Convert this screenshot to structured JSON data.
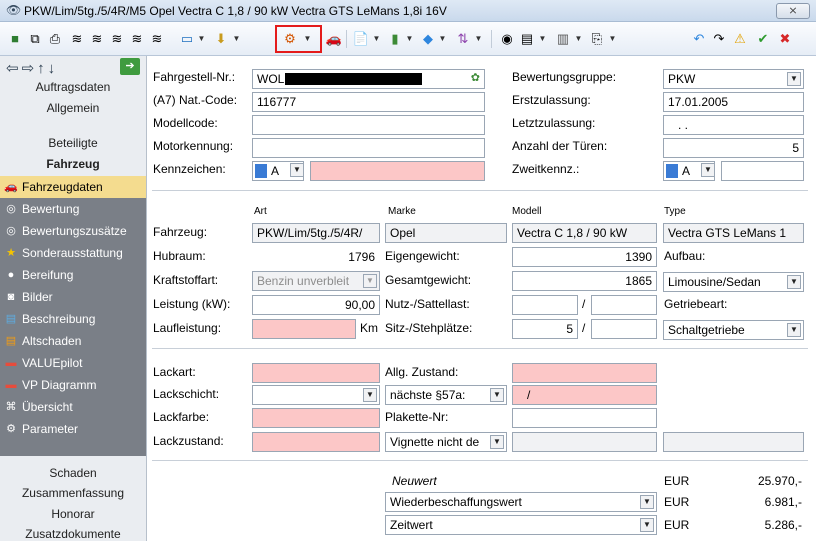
{
  "window": {
    "title": "PKW/Lim/5tg./5/4R/M5 Opel Vectra C 1,8 / 90 kW Vectra GTS LeMans 1,8i 16V",
    "close_glyph": "⨯"
  },
  "sidebar": {
    "sections_top": [
      "Auftragsdaten",
      "Allgemein",
      "Beteiligte",
      "Fahrzeug"
    ],
    "group_items": [
      "Fahrzeugdaten",
      "Bewertung",
      "Bewertungszusätze",
      "Sonderausstattung",
      "Bereifung",
      "Bilder",
      "Beschreibung",
      "Altschaden",
      "VALUEpilot",
      "VP Diagramm",
      "Übersicht",
      "Parameter"
    ],
    "sections_bottom": [
      "Schaden",
      "Zusammenfassung",
      "Honorar",
      "Zusatzdokumente"
    ]
  },
  "form": {
    "fahrgestell_label": "Fahrgestell-Nr.:",
    "fahrgestell_value": "WOL",
    "nat_code_label": "(A7) Nat.-Code:",
    "nat_code_value": "116777",
    "modellcode_label": "Modellcode:",
    "motorkennung_label": "Motorkennung:",
    "kennzeichen_label": "Kennzeichen:",
    "kennzeichen_country": "A",
    "bewertungsgruppe_label": "Bewertungsgruppe:",
    "bewertungsgruppe_value": "PKW",
    "erstzulassung_label": "Erstzulassung:",
    "erstzulassung_value": "17.01.2005",
    "letztzulassung_label": "Letztzulassung:",
    "letztzulassung_value": ". .",
    "tueren_label": "Anzahl der Türen:",
    "tueren_value": "5",
    "zweitkennz_label": "Zweitkennz.:",
    "zweitkennz_country": "A",
    "col_art": "Art",
    "col_marke": "Marke",
    "col_modell": "Modell",
    "col_type": "Type",
    "fahrzeug_label": "Fahrzeug:",
    "art_value": "PKW/Lim/5tg./5/4R/",
    "marke_value": "Opel",
    "modell_value": "Vectra C 1,8 / 90 kW",
    "type_value": "Vectra GTS LeMans 1",
    "hubraum_label": "Hubraum:",
    "hubraum_value": "1796",
    "eigengewicht_label": "Eigengewicht:",
    "eigengewicht_value": "1390",
    "aufbau_label": "Aufbau:",
    "kraftstoff_label": "Kraftstoffart:",
    "kraftstoff_value": "Benzin unverbleit",
    "gesamtgewicht_label": "Gesamtgewicht:",
    "gesamtgewicht_value": "1865",
    "aufbau_value": "Limousine/Sedan",
    "leistung_label": "Leistung (kW):",
    "leistung_value": "90,00",
    "nutzlast_label": "Nutz-/Sattellast:",
    "slash": "/",
    "getriebeart_label": "Getriebeart:",
    "laufleistung_label": "Laufleistung:",
    "km_unit": "Km",
    "sitz_label": "Sitz-/Stehplätze:",
    "sitz_value": "5",
    "getriebe_value": "Schaltgetriebe",
    "lackart_label": "Lackart:",
    "allg_zustand_label": "Allg. Zustand:",
    "lackschicht_label": "Lackschicht:",
    "naechste57_value": "nächste §57a:",
    "slash_pink": "/",
    "lackfarbe_label": "Lackfarbe:",
    "plakette_label": "Plakette-Nr:",
    "lackzustand_label": "Lackzustand:",
    "vignette_value": "Vignette nicht de",
    "neuwert_label": "Neuwert",
    "wbw_value": "Wiederbeschaffungswert",
    "zeitwert_value": "Zeitwert",
    "currency": "EUR",
    "neuwert_amount": "25.970,-",
    "wbw_amount": "6.981,-",
    "zeitwert_amount": "5.286,-"
  },
  "colors": {
    "accent_red": "#e41b1b",
    "required_pink": "#fcc7c7",
    "selected_yellow": "#f4dc8f"
  }
}
